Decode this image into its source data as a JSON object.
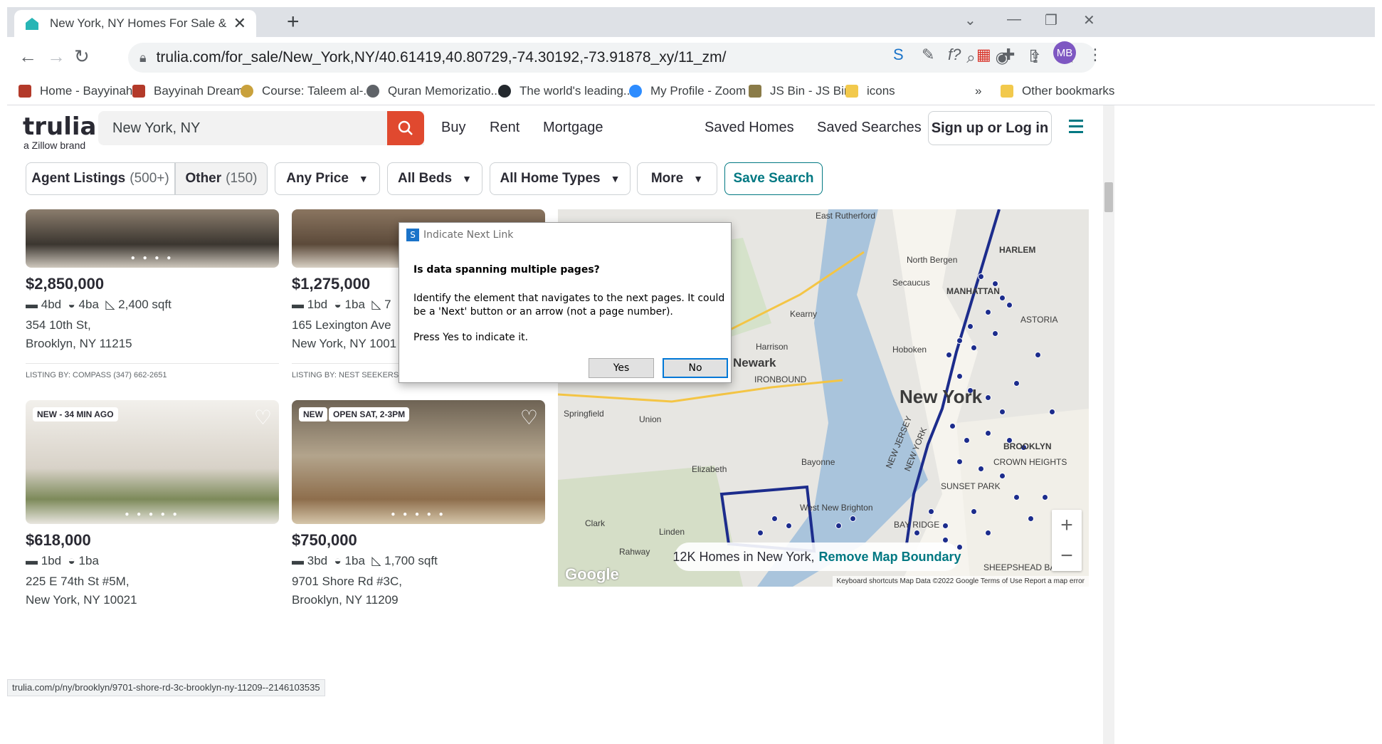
{
  "browser": {
    "tab_title": "New York, NY Homes For Sale &",
    "url": "trulia.com/for_sale/New_York,NY/40.61419,40.80729,-74.30192,-73.91878_xy/11_zm/",
    "bookmarks": [
      {
        "label": "Home - Bayyinah",
        "color": "#b33a2a"
      },
      {
        "label": "Bayyinah Dream",
        "color": "#b33a2a"
      },
      {
        "label": "Course: Taleem al-...",
        "color": "#c9a13c"
      },
      {
        "label": "Quran Memorizatio...",
        "color": "#5f6368"
      },
      {
        "label": "The world's leading...",
        "color": "#24292e"
      },
      {
        "label": "My Profile - Zoom",
        "color": "#2d8cff"
      },
      {
        "label": "JS Bin - JS Bin",
        "color": "#8a7b48"
      },
      {
        "label": "icons",
        "color": "#f2c94c"
      }
    ],
    "bookmarks_more": "»",
    "other_bookmarks": "Other bookmarks",
    "avatar": "MB"
  },
  "header": {
    "logo": "trulia",
    "logo_sub": "a Zillow brand",
    "search_value": "New York, NY",
    "nav": [
      "Buy",
      "Rent",
      "Mortgage"
    ],
    "saved_homes": "Saved Homes",
    "saved_searches": "Saved Searches",
    "signup": "Sign up or Log in"
  },
  "filters": {
    "agent": "Agent Listings",
    "agent_count": "(500+)",
    "other": "Other",
    "other_count": "(150)",
    "price": "Any Price",
    "beds": "All Beds",
    "home_types": "All Home Types",
    "more": "More",
    "save_search": "Save Search"
  },
  "listings": [
    {
      "price": "$2,850,000",
      "beds": "4bd",
      "baths": "4ba",
      "sqft": "2,400 sqft",
      "addr1": "354 10th St,",
      "addr2": "Brooklyn, NY 11215",
      "listing_by": "LISTING BY: COMPASS (347) 662-2651",
      "badges": []
    },
    {
      "price": "$1,275,000",
      "beds": "1bd",
      "baths": "1ba",
      "sqft": "7",
      "addr1": "165 Lexington Ave",
      "addr2": "New York, NY 1001",
      "listing_by": "LISTING BY: NEST SEEKERS IN",
      "badges": []
    },
    {
      "price": "$618,000",
      "beds": "1bd",
      "baths": "1ba",
      "sqft": "",
      "addr1": "225 E 74th St #5M,",
      "addr2": "New York, NY 10021",
      "listing_by": "",
      "badges": [
        "NEW - 34 MIN AGO"
      ]
    },
    {
      "price": "$750,000",
      "beds": "3bd",
      "baths": "1ba",
      "sqft": "1,700 sqft",
      "addr1": "9701 Shore Rd #3C,",
      "addr2": "Brooklyn, NY 11209",
      "listing_by": "",
      "badges": [
        "NEW",
        "OPEN SAT, 2-3PM"
      ]
    }
  ],
  "map": {
    "homes_text": "12K Homes in New York,",
    "remove_boundary": "Remove Map Boundary",
    "labels": [
      "East Rutherford",
      "North Bergen",
      "HARLEM",
      "Secaucus",
      "Kearny",
      "MANHATTAN",
      "ASTORIA",
      "Harrison",
      "Hoboken",
      "Newark",
      "IRONBOUND",
      "New York",
      "Springfield",
      "Union",
      "Bayonne",
      "Elizabeth",
      "BROOKLYN",
      "CROWN HEIGHTS",
      "SUNSET PARK",
      "West New Brighton",
      "Clark",
      "Linden",
      "Rahway",
      "BAY RIDGE",
      "SHEEPSHEAD BAY",
      "NEW JERSEY",
      "NEW YORK"
    ],
    "footer": "Keyboard shortcuts   Map Data ©2022 Google   Terms of Use   Report a map error",
    "google": "Google"
  },
  "dialog": {
    "title": "Indicate Next Link",
    "question": "Is data spanning multiple pages?",
    "body": "Identify the element that navigates to the next pages. It could be a 'Next' button or an arrow (not a page number).",
    "body2": "Press Yes to indicate it.",
    "yes": "Yes",
    "no": "No"
  },
  "status_url": "trulia.com/p/ny/brooklyn/9701-shore-rd-3c-brooklyn-ny-11209--2146103535"
}
